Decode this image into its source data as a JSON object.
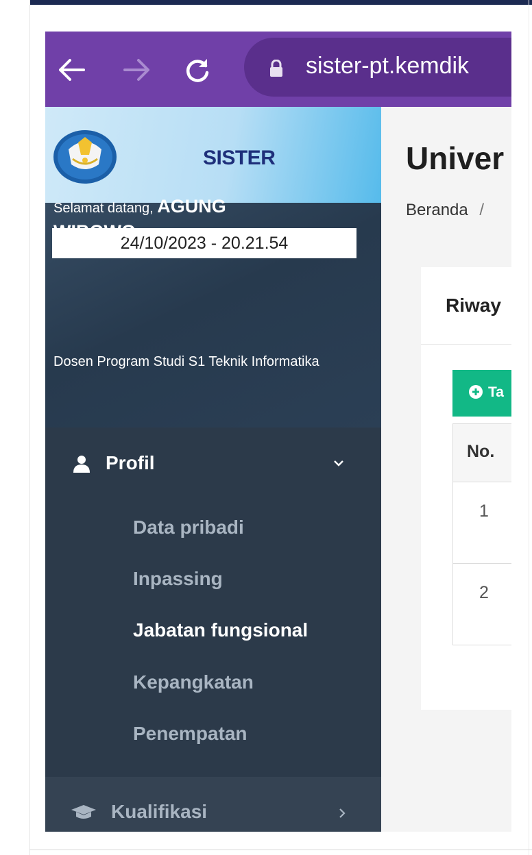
{
  "browser": {
    "url": "sister-pt.kemdik",
    "back_icon": "arrow-left-icon",
    "forward_icon": "arrow-right-icon",
    "reload_icon": "reload-icon",
    "lock_icon": "lock-icon",
    "bar_color": "#7040a8"
  },
  "sidebar": {
    "brand_name": "SISTER",
    "datetime": "24/10/2023 - 20.21.54",
    "welcome_prefix": "Selamat datang, ",
    "user_name_line1": "AGUNG",
    "user_name_line2": "WIBOWO",
    "role": "Dosen Program Studi S1 Teknik Informatika",
    "menu": {
      "label": "Profil",
      "icon": "user-icon",
      "expanded": true,
      "items": [
        {
          "label": "Data pribadi",
          "active": false
        },
        {
          "label": "Inpassing",
          "active": false
        },
        {
          "label": "Jabatan fungsional",
          "active": true
        },
        {
          "label": "Kepangkatan",
          "active": false
        },
        {
          "label": "Penempatan",
          "active": false
        }
      ]
    },
    "next_menu": {
      "label": "Kualifikasi",
      "icon": "graduation-cap-icon"
    }
  },
  "content": {
    "title": "Univer",
    "breadcrumb_home": "Beranda",
    "breadcrumb_sep": "/",
    "card_title": "Riway",
    "add_button_label": "Ta",
    "table": {
      "header_no": "No.",
      "rows": [
        "1",
        "2"
      ]
    },
    "accent_color": "#12b886"
  }
}
